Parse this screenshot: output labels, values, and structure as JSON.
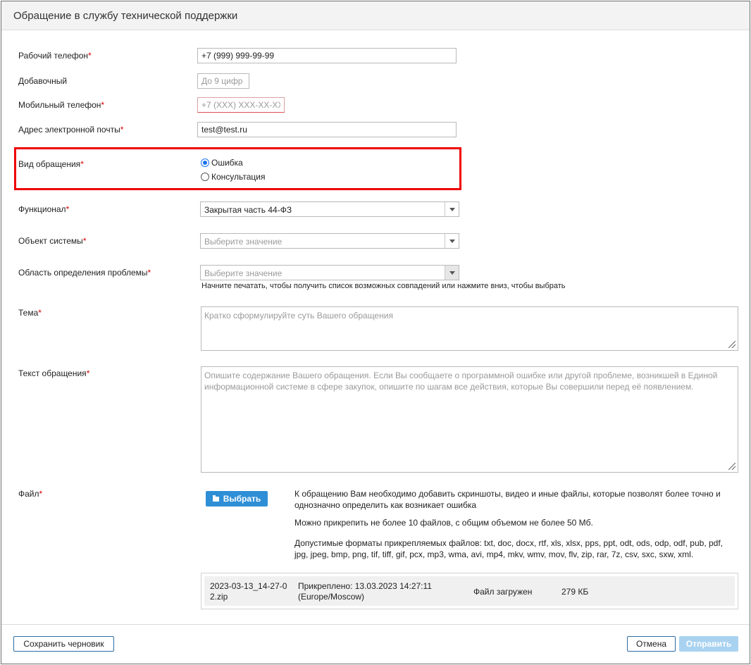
{
  "dialog": {
    "title": "Обращение в службу технической поддержки"
  },
  "fields": {
    "work_phone": {
      "label": "Рабочий телефон",
      "value": "+7 (999) 999-99-99"
    },
    "extension": {
      "label": "Добавочный",
      "placeholder": "До 9 цифр"
    },
    "mobile_phone": {
      "label": "Мобильный телефон",
      "placeholder": "+7 (XXX) XXX-XX-XX"
    },
    "email": {
      "label": "Адрес электронной почты",
      "value": "test@test.ru"
    },
    "request_type": {
      "label": "Вид обращения",
      "options": [
        "Ошибка",
        "Консультация"
      ],
      "selected": "Ошибка"
    },
    "functional": {
      "label": "Функционал",
      "value": "Закрытая часть 44-ФЗ"
    },
    "system_object": {
      "label": "Объект системы",
      "placeholder": "Выберите значение"
    },
    "problem_area": {
      "label": "Область определения проблемы",
      "placeholder": "Выберите значение",
      "hint": "Начните печатать, чтобы получить список возможных совпадений или нажмите вниз, чтобы выбрать"
    },
    "subject": {
      "label": "Тема",
      "placeholder": "Кратко сформулируйте суть Вашего обращения"
    },
    "message": {
      "label": "Текст обращения",
      "placeholder": "Опишите содержание Вашего обращения. Если Вы сообщаете о программной ошибке или другой проблеме, возникшей в Единой информационной системе в сфере закупок, опишите по шагам все действия, которые Вы совершили перед её появлением."
    },
    "file": {
      "label": "Файл",
      "button_label": "Выбрать",
      "info_1": "К обращению Вам необходимо добавить скриншоты, видео и иные файлы, которые позволят более точно и однозначно определить как возникает ошибка",
      "info_2": "Можно прикрепить не более 10 файлов, с общим объемом не более 50 Мб.",
      "info_3": "Допустимые форматы прикрепляемых файлов: txt, doc, docx, rtf, xls, xlsx, pps, ppt, odt, ods, odp, odf, pub, pdf, jpg, jpeg, bmp, png, tif, tiff, gif, pcx, mp3, wma, avi, mp4, mkv, wmv, mov, flv, zip, rar, 7z, csv, sxc, sxw, xml."
    },
    "attached": {
      "name_line1": "2023-03-13_14-27-0",
      "name_line2": "2.zip",
      "attached_line1": "Прикреплено: 13.03.2023 14:27:11",
      "attached_line2": "(Europe/Moscow)",
      "status": "Файл загружен",
      "size": "279 КБ"
    }
  },
  "required_mark": "*",
  "footer": {
    "save_draft": "Сохранить черновик",
    "cancel": "Отмена",
    "submit": "Отправить"
  },
  "colors": {
    "highlight": "#ee0000",
    "primary": "#2e8fd6",
    "required": "#d40000"
  }
}
